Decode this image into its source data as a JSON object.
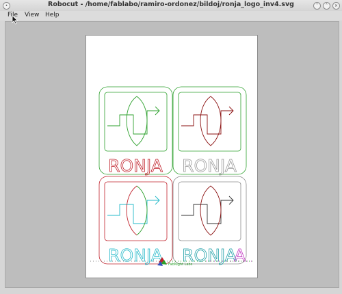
{
  "window": {
    "title": "Robocut - /home/fablabo/ramiro-ordonez/bildoj/ronja_logo_inv4.svg"
  },
  "menubar": {
    "items": [
      {
        "label": "File"
      },
      {
        "label": "View"
      },
      {
        "label": "Help"
      }
    ]
  },
  "design": {
    "tiles": [
      {
        "word": "RONJA",
        "frame_color": "#2ca02c",
        "symbol_color": "#2ca02c",
        "word_color": "#c0202a"
      },
      {
        "word": "RONJA",
        "frame_color": "#2ca02c",
        "symbol_color": "#8b1010",
        "word_color": "#9a9a9a"
      },
      {
        "word": "RONJA",
        "frame_color": "#c0202a",
        "symbol_color": "#20b8c8",
        "word_color": "#20b8c8"
      },
      {
        "word": "RONJA",
        "frame_color": "#8a8a8a",
        "symbol_color": "#333333",
        "word_color": "#20a0a8"
      }
    ],
    "footer_text": "FabNight Labs"
  },
  "colors": {
    "green": "#2ca02c",
    "red": "#c0202a",
    "cyan": "#20b8c8",
    "magenta": "#c030c0",
    "gray": "#8a8a8a"
  }
}
